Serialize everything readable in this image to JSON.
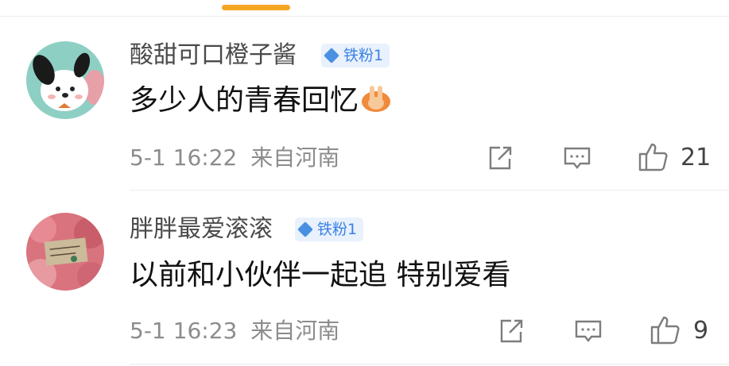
{
  "comments": [
    {
      "username": "酸甜可口橙子酱",
      "badge": "铁粉1",
      "content": "多少人的青春回忆",
      "emoji": "clapping-hands-emoji",
      "date": "5-1 16:22",
      "location": "来自河南",
      "likes": "21",
      "avatar": "pochacco-dog-avatar"
    },
    {
      "username": "胖胖最爱滚滚",
      "badge": "铁粉1",
      "content": "以前和小伙伴一起追 特别爱看",
      "date": "5-1 16:23",
      "location": "来自河南",
      "likes": "9",
      "avatar": "pink-flowers-note-avatar"
    }
  ],
  "icons": {
    "share": "share-icon",
    "comment": "comment-icon",
    "like": "thumbs-up-icon"
  },
  "colors": {
    "accent": "#f5a623",
    "badge_bg": "#e8f1fc",
    "badge_text": "#3b82e6"
  }
}
